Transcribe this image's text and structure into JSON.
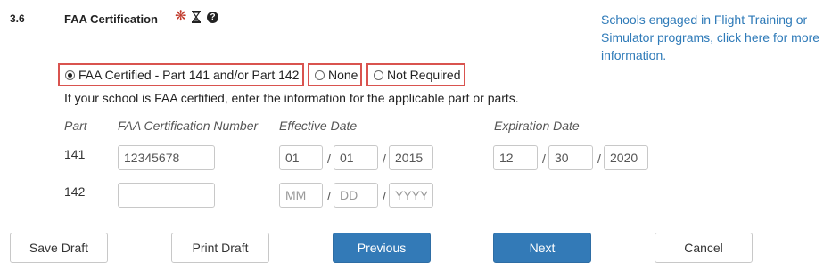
{
  "section": {
    "number": "3.6",
    "title": "FAA Certification",
    "required_symbol": "❋",
    "help_symbol": "?",
    "icons": [
      "required-icon",
      "hourglass-icon",
      "help-icon"
    ]
  },
  "info_link": "Schools engaged in Flight Training or Simulator programs, click here for more information.",
  "options": [
    {
      "label": "FAA Certified - Part 141 and/or Part 142",
      "checked": true
    },
    {
      "label": "None",
      "checked": false
    },
    {
      "label": "Not Required",
      "checked": false
    }
  ],
  "hint": "If your school is FAA certified, enter the information for the applicable part or parts.",
  "columns": {
    "part": "Part",
    "cert_number": "FAA Certification Number",
    "effective": "Effective Date",
    "expiration": "Expiration Date"
  },
  "rows": [
    {
      "part": "141",
      "cert_number": "12345678",
      "effective": {
        "mm": "01",
        "dd": "01",
        "yyyy": "2015"
      },
      "expiration": {
        "mm": "12",
        "dd": "30",
        "yyyy": "2020"
      }
    },
    {
      "part": "142",
      "cert_number": "",
      "effective": {
        "mm": "",
        "dd": "",
        "yyyy": ""
      },
      "effective_placeholder": {
        "mm": "MM",
        "dd": "DD",
        "yyyy": "YYYY"
      }
    }
  ],
  "date_separator": "/",
  "buttons": {
    "save_draft": "Save Draft",
    "print_draft": "Print Draft",
    "previous": "Previous",
    "next": "Next",
    "cancel": "Cancel"
  },
  "colors": {
    "accent": "#337ab7",
    "link": "#2e7ab8",
    "highlight_border": "#d9534f",
    "required": "#c0392b"
  }
}
